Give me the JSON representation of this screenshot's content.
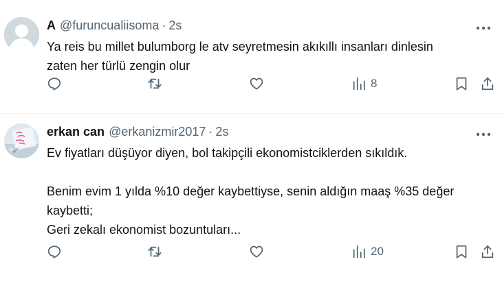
{
  "tweets": [
    {
      "avatar": "default-avatar",
      "display_name": "A",
      "handle": "@furuncualiisoma",
      "separator": "·",
      "time": "2s",
      "text": "Ya reis bu millet bulumborg le atv seyretmesin akıkıllı insanları dinlesin\nzaten her türlü zengin olur",
      "views": "8"
    },
    {
      "avatar": "photo-avatar",
      "display_name": "erkan can",
      "handle": "@erkanizmir2017",
      "separator": "·",
      "time": "2s",
      "text": "Ev fiyatları düşüyor diyen, bol takipçili ekonomistciklerden sıkıldık.\n\nBenim evim 1 yılda %10 değer kaybettiyse, senin aldığın maaş %35 değer\nkaybetti;\nGeri zekalı ekonomist bozuntuları...",
      "views": "20"
    }
  ],
  "icons": {
    "reply": "reply-icon",
    "retweet": "retweet-icon",
    "like": "heart-icon",
    "views": "views-chart-icon",
    "bookmark": "bookmark-icon",
    "share": "share-icon",
    "more": "more-dots-icon"
  },
  "colors": {
    "text": "#0f1419",
    "secondary": "#536471",
    "divider": "#eff3f4"
  }
}
